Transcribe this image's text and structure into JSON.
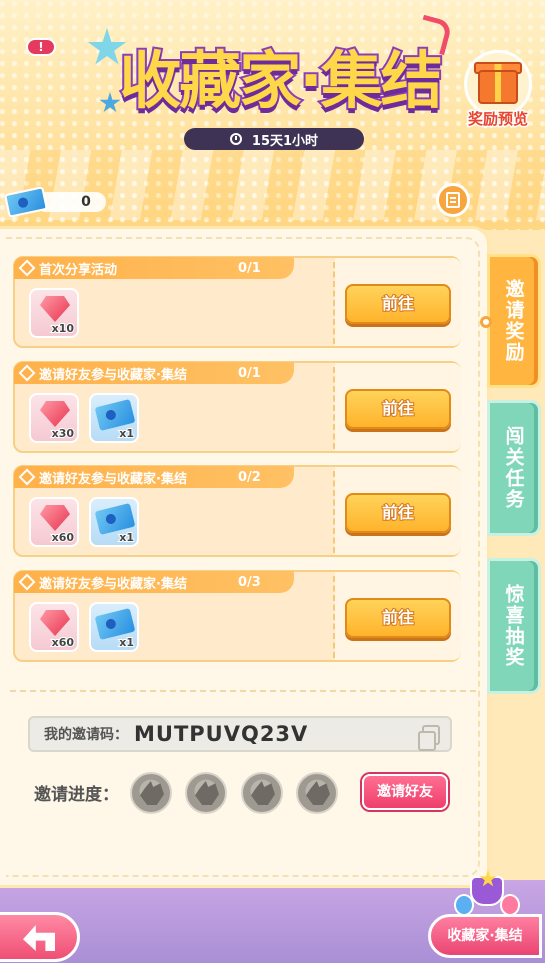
{
  "header": {
    "alert": "!",
    "title": "收藏家·集结",
    "timer": "15天1小时",
    "reward_preview_label": "奖励预览"
  },
  "currency": {
    "ticket_count": "0"
  },
  "side_tabs": [
    {
      "label": "邀请奖励",
      "active": true
    },
    {
      "label": "闯关任务",
      "active": false
    },
    {
      "label": "惊喜抽奖",
      "active": false
    }
  ],
  "tasks": [
    {
      "name": "首次分享活动",
      "progress": "0/1",
      "rewards": [
        {
          "type": "gem",
          "qty": "x10"
        }
      ],
      "button": "前往"
    },
    {
      "name": "邀请好友参与收藏家·集结",
      "progress": "0/1",
      "rewards": [
        {
          "type": "gem",
          "qty": "x30"
        },
        {
          "type": "ticket",
          "qty": "x1"
        }
      ],
      "button": "前往"
    },
    {
      "name": "邀请好友参与收藏家·集结",
      "progress": "0/2",
      "rewards": [
        {
          "type": "gem",
          "qty": "x60"
        },
        {
          "type": "ticket",
          "qty": "x1"
        }
      ],
      "button": "前往"
    },
    {
      "name": "邀请好友参与收藏家·集结",
      "progress": "0/3",
      "rewards": [
        {
          "type": "gem",
          "qty": "x60"
        },
        {
          "type": "ticket",
          "qty": "x1"
        }
      ],
      "button": "前往"
    }
  ],
  "invite": {
    "code_label": "我的邀请码：",
    "code_value": "MUTPUVQ23V",
    "progress_label": "邀请进度：",
    "slots_filled": 0,
    "slots_total": 4,
    "invite_button": "邀请好友"
  },
  "footer": {
    "collector_button": "收藏家·集结"
  },
  "colors": {
    "accent": "#ffb53f",
    "pink": "#ef3f6b",
    "tab_inactive": "#7fd6b8",
    "title_fill": "#ffd84a",
    "title_stroke": "#8a3fb8"
  }
}
